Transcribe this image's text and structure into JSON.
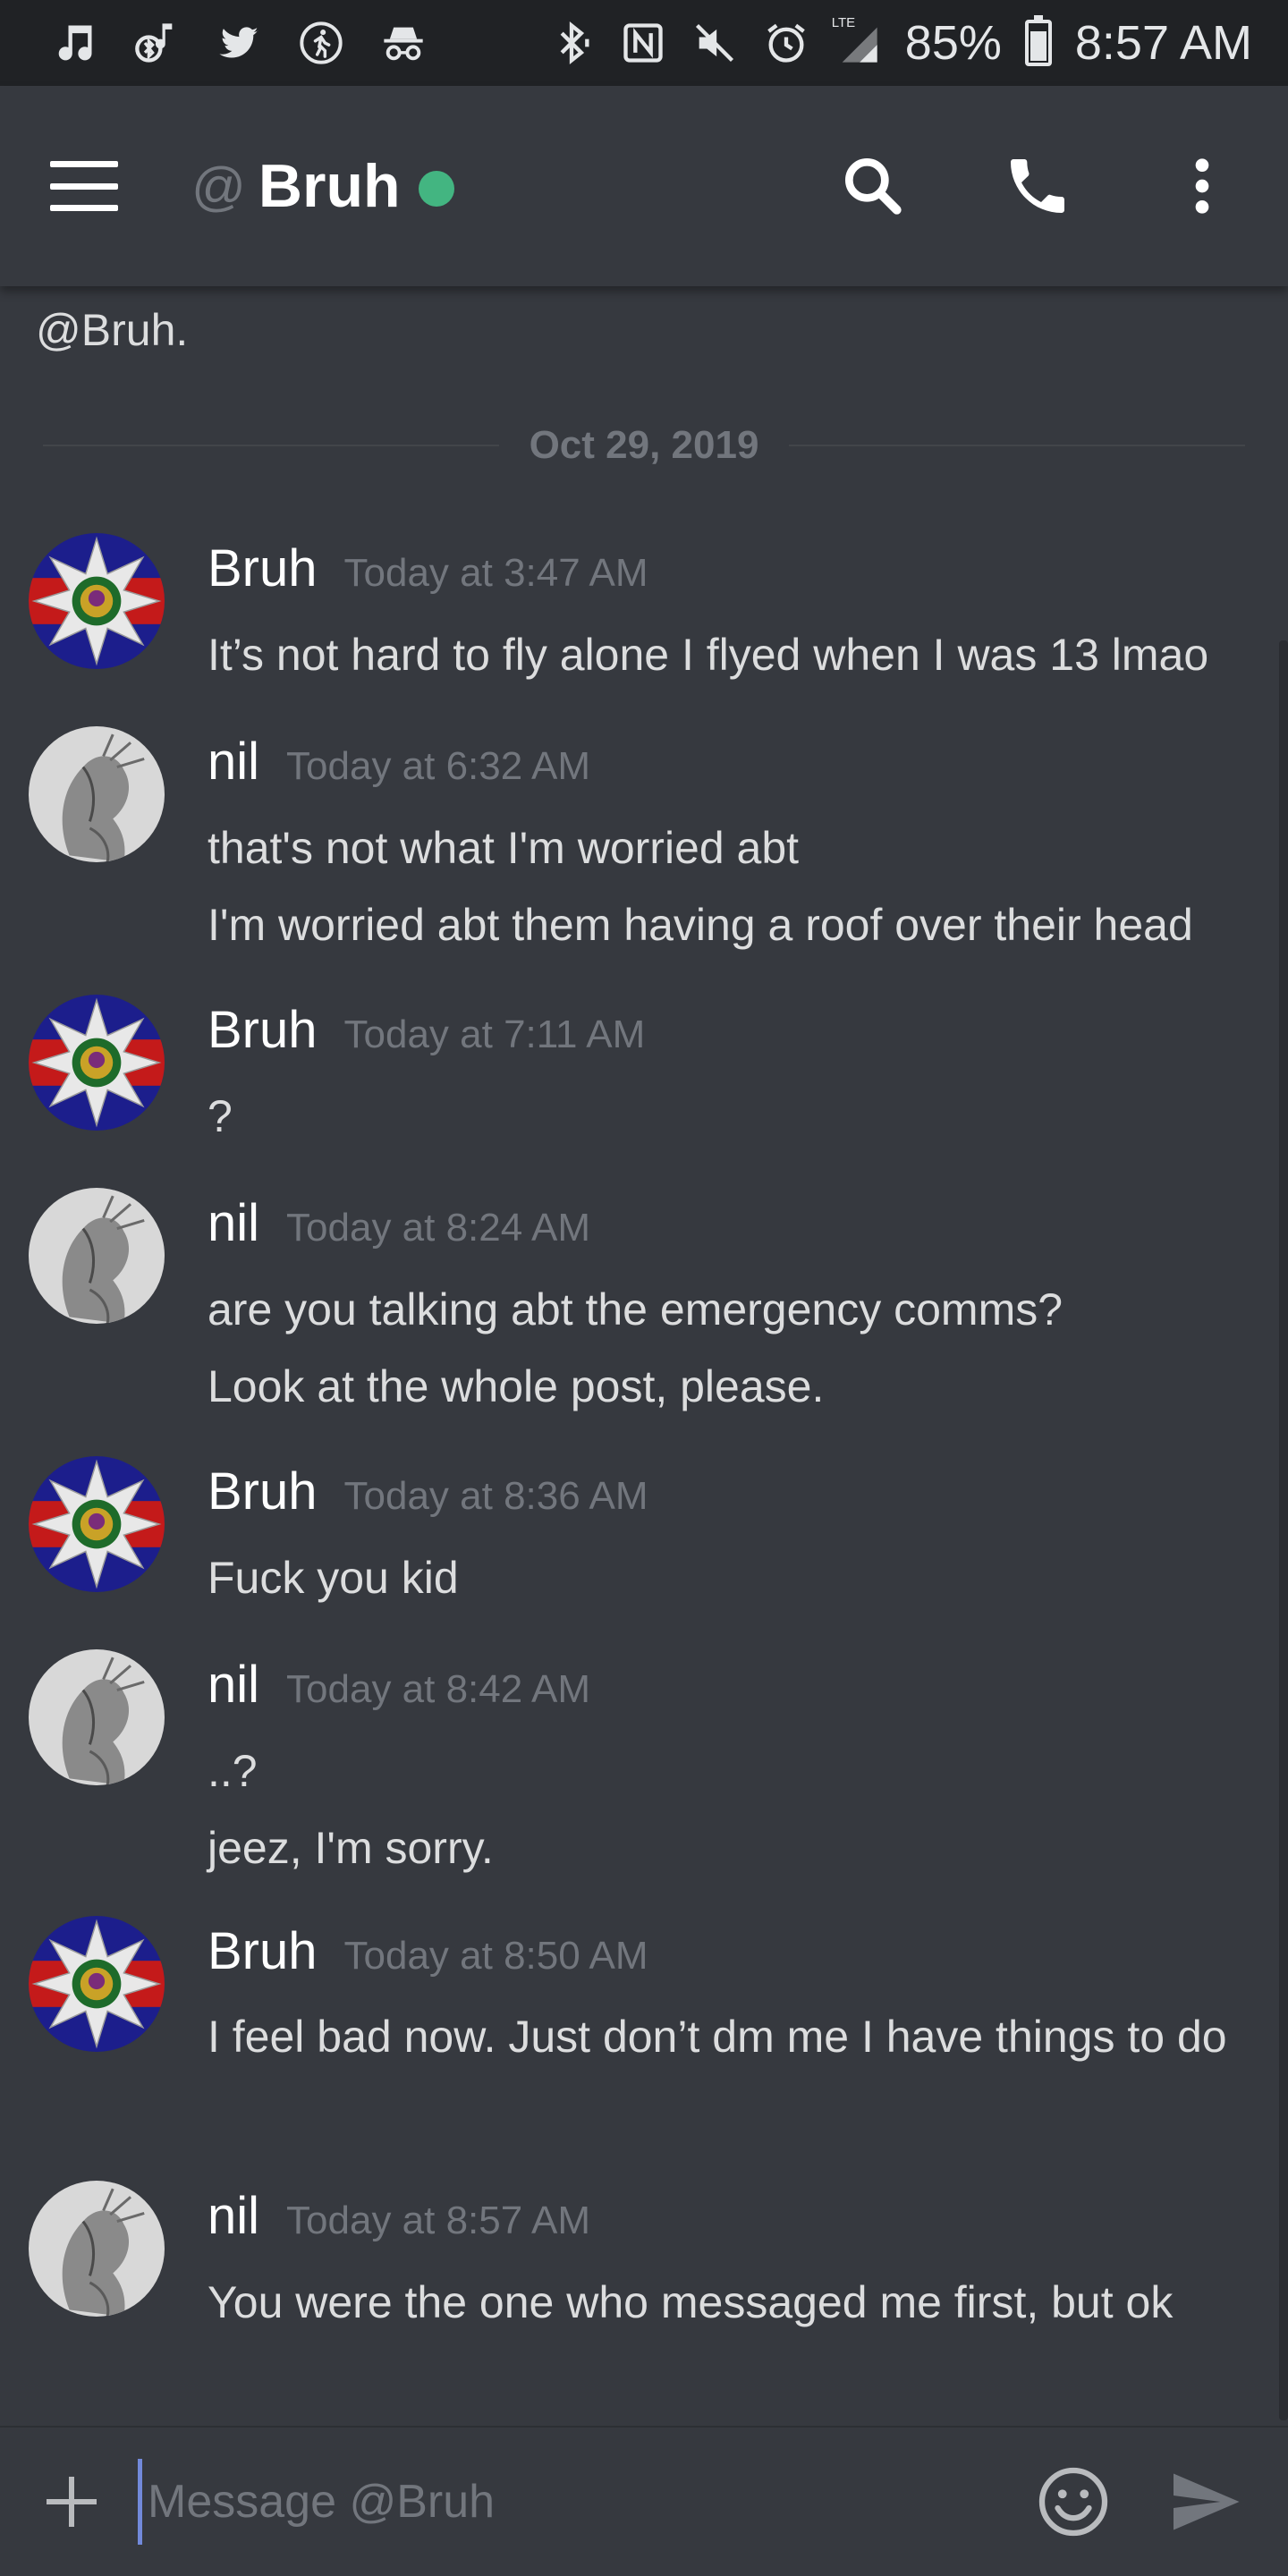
{
  "status_bar": {
    "left_icons": [
      "music-icon",
      "bluetooth-music-icon",
      "twitter-icon",
      "running-icon",
      "incognito-icon"
    ],
    "right_icons": [
      "bluetooth-icon",
      "nfc-icon",
      "mute-icon",
      "alarm-icon",
      "signal-icon"
    ],
    "network_label": "LTE",
    "battery_percent": "85%",
    "battery_level": 0.85,
    "time": "8:57 AM"
  },
  "header": {
    "at_symbol": "@",
    "channel_name": "Bruh",
    "status": "online",
    "status_color": "#43b581",
    "actions": [
      "search-icon",
      "phone-icon",
      "more-vertical-icon"
    ]
  },
  "conversation": {
    "intro_text": "@Bruh.",
    "date_divider": "Oct 29, 2019",
    "messages": [
      {
        "author": "Bruh",
        "avatar": "regimental-badge-avatar",
        "timestamp": "Today at 3:47 AM",
        "lines": [
          "It’s not hard to fly alone I flyed when I was 13 lmao"
        ]
      },
      {
        "author": "nil",
        "avatar": "grey-sketch-avatar",
        "timestamp": "Today at 6:32 AM",
        "lines": [
          "that's not what I'm worried abt",
          "I'm worried abt them having a roof over their head"
        ]
      },
      {
        "author": "Bruh",
        "avatar": "regimental-badge-avatar",
        "timestamp": "Today at 7:11 AM",
        "lines": [
          "?"
        ]
      },
      {
        "author": "nil",
        "avatar": "grey-sketch-avatar",
        "timestamp": "Today at 8:24 AM",
        "lines": [
          "are you talking abt the emergency comms?",
          "Look at the whole post, please."
        ]
      },
      {
        "author": "Bruh",
        "avatar": "regimental-badge-avatar",
        "timestamp": "Today at 8:36 AM",
        "lines": [
          "Fuck you kid"
        ]
      },
      {
        "author": "nil",
        "avatar": "grey-sketch-avatar",
        "timestamp": "Today at 8:42 AM",
        "lines": [
          "..?",
          "jeez, I'm sorry."
        ]
      },
      {
        "author": "Bruh",
        "avatar": "regimental-badge-avatar",
        "timestamp": "Today at 8:50 AM",
        "lines": [
          "I feel bad now. Just don’t dm me I have things to do"
        ]
      },
      {
        "author": "nil",
        "avatar": "grey-sketch-avatar",
        "timestamp": "Today at 8:57 AM",
        "lines": [
          "You were the one who messaged me first, but ok"
        ]
      }
    ]
  },
  "composer": {
    "value": "",
    "placeholder": "Message @Bruh",
    "icons": [
      "plus-icon",
      "emoji-icon",
      "send-icon"
    ],
    "accent_color": "#7289da"
  },
  "theme": {
    "background": "#36393f",
    "status_bar_bg": "#202225",
    "muted_text": "#72767d"
  }
}
